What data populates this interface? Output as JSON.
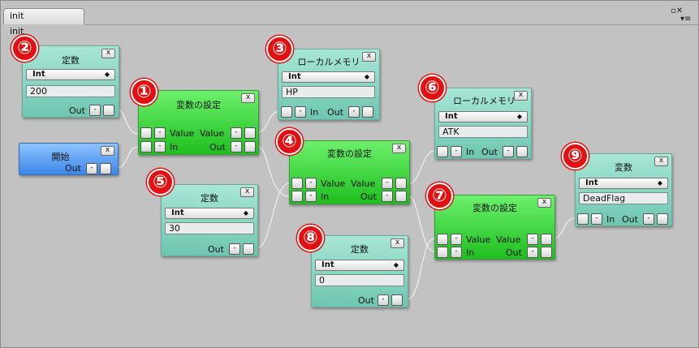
{
  "window": {
    "tab_title": "init",
    "canvas_label": "init",
    "ctrl_close": "▫✕",
    "ctrl_menu": "▾≡"
  },
  "glyphs": {
    "btn_minus": "-",
    "btn_close": "x",
    "dropdown_arrow": "◆"
  },
  "badges": [
    "②",
    "①",
    "③",
    "④",
    "⑤",
    "⑥",
    "⑦",
    "⑧",
    "⑨"
  ],
  "nodes": {
    "const1": {
      "title": "定数",
      "type": "Int",
      "value": "200",
      "out": "Out"
    },
    "start": {
      "title": "開始",
      "out": "Out"
    },
    "setvar1": {
      "title": "変数の設定",
      "value_in": "Value",
      "value_out": "Value",
      "in": "In",
      "out": "Out"
    },
    "local1": {
      "title": "ローカルメモリ",
      "type": "Int",
      "value": "HP",
      "in": "In",
      "out": "Out"
    },
    "setvar2": {
      "title": "変数の設定",
      "value_in": "Value",
      "value_out": "Value",
      "in": "In",
      "out": "Out"
    },
    "const2": {
      "title": "定数",
      "type": "Int",
      "value": "30",
      "out": "Out"
    },
    "local2": {
      "title": "ローカルメモリ",
      "type": "Int",
      "value": "ATK",
      "in": "In",
      "out": "Out"
    },
    "setvar3": {
      "title": "変数の設定",
      "value_in": "Value",
      "value_out": "Value",
      "in": "In",
      "out": "Out"
    },
    "const3": {
      "title": "定数",
      "type": "Int",
      "value": "0",
      "out": "Out"
    },
    "var1": {
      "title": "変数",
      "type": "Int",
      "value": "DeadFlag",
      "in": "In",
      "out": "Out"
    }
  }
}
